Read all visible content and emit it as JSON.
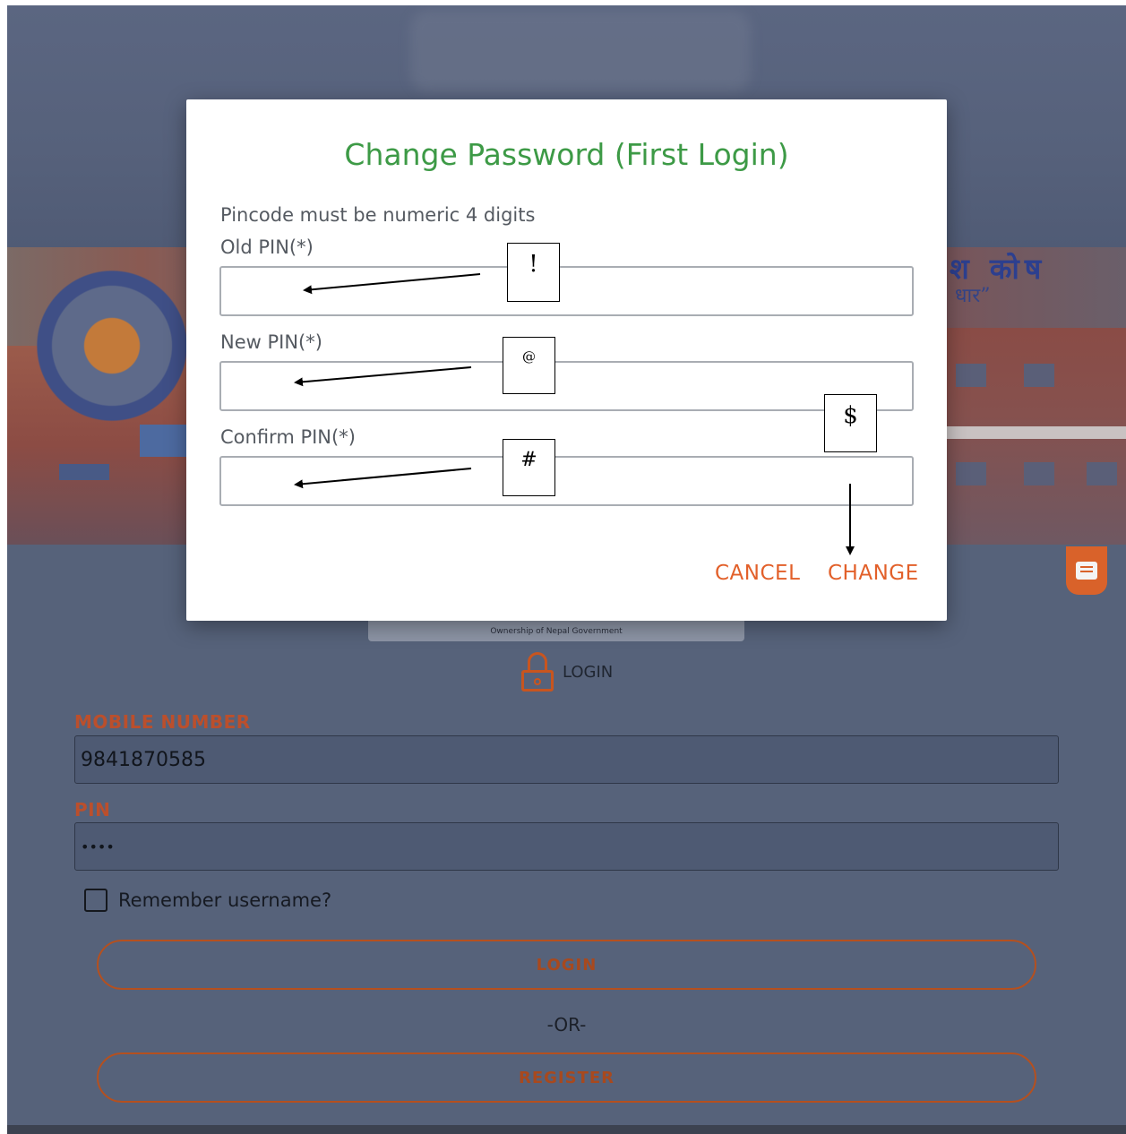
{
  "modal": {
    "title": "Change Password (First Login)",
    "hint": "Pincode must be numeric 4 digits",
    "old_pin_label": "Old PIN(*)",
    "new_pin_label": "New PIN(*)",
    "confirm_pin_label": "Confirm PIN(*)",
    "cancel_label": "CANCEL",
    "change_label": "CHANGE"
  },
  "background_page": {
    "banner_text_line1": "श कोष",
    "banner_text_line2": "धार”",
    "logo_caption": "Ownership of Nepal Government",
    "login_heading": "LOGIN",
    "mobile_label": "MOBILE NUMBER",
    "mobile_value": "9841870585",
    "pin_label": "PIN",
    "pin_value": "••••",
    "remember_label": "Remember username?",
    "login_button": "LOGIN",
    "or_text": "-OR-",
    "register_button": "REGISTER"
  },
  "annotations": {
    "old_pin_marker": "!",
    "new_pin_marker": "@",
    "confirm_pin_marker": "#",
    "change_marker": "$"
  },
  "colors": {
    "title_green": "#3d9a46",
    "action_orange": "#e2602a",
    "overlay_blue_gray": "#56627a"
  },
  "icons": [
    "lock-icon",
    "chat-icon",
    "checkbox-icon"
  ]
}
